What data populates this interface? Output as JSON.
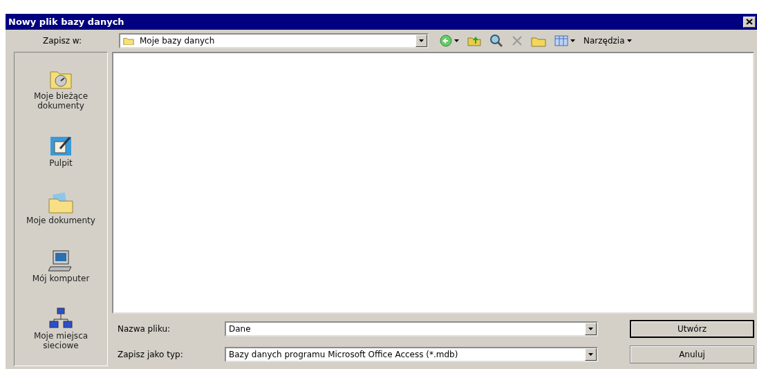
{
  "window": {
    "title": "Nowy plik bazy danych"
  },
  "save_in": {
    "label": "Zapisz w:",
    "value": "Moje bazy danych"
  },
  "toolbar": {
    "tools_menu": "Narzędzia"
  },
  "places": [
    {
      "kind": "recent",
      "label": "Moje bieżące dokumenty"
    },
    {
      "kind": "desktop",
      "label": "Pulpit"
    },
    {
      "kind": "documents",
      "label": "Moje dokumenty"
    },
    {
      "kind": "computer",
      "label": "Mój komputer"
    },
    {
      "kind": "network",
      "label": "Moje miejsca sieciowe"
    }
  ],
  "file_name": {
    "label": "Nazwa pliku:",
    "value": "Dane"
  },
  "file_type": {
    "label": "Zapisz jako typ:",
    "value": "Bazy danych programu Microsoft Office Access (*.mdb)"
  },
  "buttons": [
    {
      "label": "Utwórz",
      "default": true
    },
    {
      "label": "Anuluj",
      "default": false
    }
  ]
}
